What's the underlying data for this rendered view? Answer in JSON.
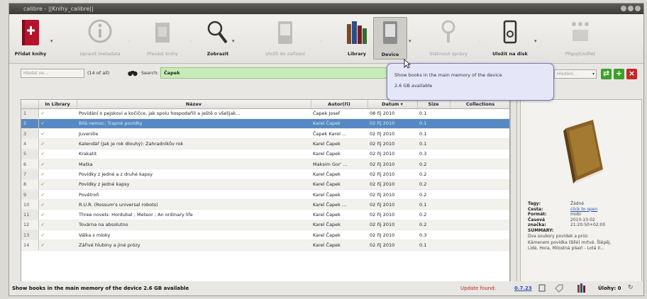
{
  "window": {
    "title": "calibre - ||Knihy_calibre||"
  },
  "toolbar": {
    "add": "Přidat knihy",
    "edit_meta": "Upravit metadata",
    "convert": "Převést knihy",
    "view": "Zobrazit",
    "send": "Uložit do zařízení",
    "library": "Library",
    "device": "Device",
    "news": "Stáhnout zprávy",
    "save": "Uložit na disk",
    "connect": "Připojit/sdílet"
  },
  "search": {
    "combo": "Hledat ve...",
    "count": "(14 of all)",
    "label": "Search:",
    "value": "Čapek",
    "saved": "Hledání..."
  },
  "grid": {
    "columns": [
      "",
      "In Library",
      "Název",
      "Autor(ři)",
      "Datum",
      "Size",
      "Collections"
    ],
    "check": "✓",
    "rows": [
      {
        "n": "1",
        "title": "Povídání o pejskovi a kočičce, jak spolu hospodařili a ještě o všelijak...",
        "author": "Čapek Josef",
        "date": "08 říj 2010",
        "size": "0.1"
      },
      {
        "n": "2",
        "title": "Bílá nemoc; Trapné povídky",
        "author": "Karel Čapek",
        "date": "02 říj 2010",
        "size": "0.1"
      },
      {
        "n": "3",
        "title": "Juvenilie",
        "author": "Čapek Karel ...",
        "date": "02 říj 2010",
        "size": "0.1"
      },
      {
        "n": "4",
        "title": "Kalendář (Jak je rok dlouhý): Zahradníkův rok",
        "author": "Karel Čapek",
        "date": "02 říj 2010",
        "size": "0.1"
      },
      {
        "n": "5",
        "title": "Krakatit",
        "author": "Karel Čapek",
        "date": "02 říj 2010",
        "size": "0.3"
      },
      {
        "n": "6",
        "title": "Matka",
        "author": "Maksim Gor' ...",
        "date": "02 říj 2010",
        "size": "0.2"
      },
      {
        "n": "7",
        "title": "Povídky z jedné a z druhé kapsy",
        "author": "Karel Čapek",
        "date": "02 říj 2010",
        "size": "0.2"
      },
      {
        "n": "8",
        "title": "Povídky z jedné kapsy",
        "author": "Karel Čapek",
        "date": "02 říj 2010",
        "size": "0.2"
      },
      {
        "n": "9",
        "title": "Povětroň",
        "author": "Karel Čapek",
        "date": "02 říj 2010",
        "size": "0.2"
      },
      {
        "n": "10",
        "title": "R.U.R. (Rossum's universal robots)",
        "author": "Karel Čapek ...",
        "date": "02 říj 2010",
        "size": "0.1"
      },
      {
        "n": "11",
        "title": "Three novels: Hordubal ; Meteor ; An ordinary life",
        "author": "Karel Čapek",
        "date": "02 říj 2010",
        "size": "0.2"
      },
      {
        "n": "12",
        "title": "Továrna na absolutno",
        "author": "Karel Čapek",
        "date": "02 říj 2010",
        "size": "0.2"
      },
      {
        "n": "13",
        "title": "Válka s mloky",
        "author": "Karel Čapek",
        "date": "02 říj 2010",
        "size": "0.3"
      },
      {
        "n": "14",
        "title": "Zářivé hlubiny a jiné prózy",
        "author": "Karel Čapek",
        "date": "02 říj 2010",
        "size": "0.1"
      }
    ]
  },
  "details": {
    "tags_k": "Tagy:",
    "tags_v": "Žádné",
    "path_k": "Cesta:",
    "path_v": "click to open",
    "format_k": "Formát:",
    "format_v": "mobi",
    "time_k": "Časová",
    "time_v": "2010-10-02",
    "mark_k": "značka:",
    "mark_v": "21:20:50+02:00",
    "summary_k": "SUMMARY:",
    "desc1": "Dva soubory povídek a próz:",
    "desc2": "Kámenem povídka (Bílé) mrtvé. Šlépěj,",
    "desc3": "Lidé, Hora, Milostná píseň - Lotá II..."
  },
  "status": {
    "left": "Show books in the main memory of the device  2.6 GB available",
    "update": "Update found:",
    "version": "0.7.23",
    "jobs": "Úlohy: 0"
  },
  "tooltip": {
    "line1": "Show books in the main memory of the device",
    "line2": "2.6 GB available"
  }
}
